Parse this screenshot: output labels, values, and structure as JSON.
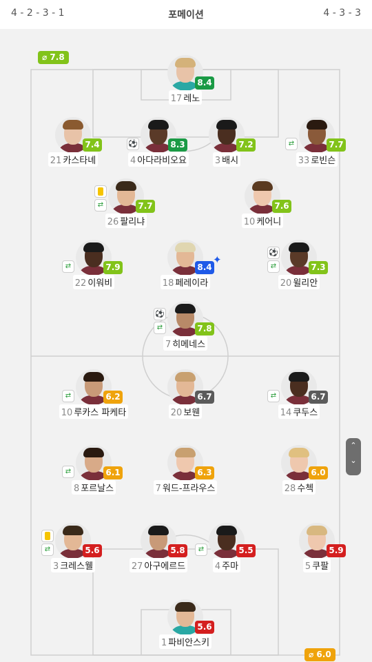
{
  "header": {
    "home_formation": "4 - 2 - 3 - 1",
    "title": "포메이션",
    "away_formation": "4 - 3 - 3"
  },
  "team_ratings": {
    "home": "7.8",
    "away": "6.0",
    "avg_symbol": "⌀"
  },
  "colors": {
    "rating_green": "#82c31a",
    "rating_dark_green": "#1a9a45",
    "rating_blue": "#1f5ae8",
    "rating_gray": "#5b5b5b",
    "rating_orange": "#efa30c",
    "rating_red": "#d41f1f",
    "home_shirt": "#7a2f3a",
    "gk_shirt": "#2aa8a4"
  },
  "players": [
    {
      "id": "reno",
      "number": "17",
      "name": "레노",
      "rating": "8.4",
      "rating_color": "#1a9a45",
      "gk": true,
      "skin": "#e8c3a8",
      "hair": "#d4b27a",
      "events": []
    },
    {
      "id": "castagne",
      "number": "21",
      "name": "카스타녜",
      "rating": "7.4",
      "rating_color": "#82c31a",
      "skin": "#e8c3a8",
      "hair": "#8a5a30",
      "events": []
    },
    {
      "id": "adarabioyo",
      "number": "4",
      "name": "아다라비오요",
      "rating": "8.3",
      "rating_color": "#1a9a45",
      "skin": "#5a3a28",
      "hair": "#1a1a1a",
      "events": [
        "ball"
      ]
    },
    {
      "id": "bassey",
      "number": "3",
      "name": "배시",
      "rating": "7.2",
      "rating_color": "#82c31a",
      "skin": "#4a2e20",
      "hair": "#1a1a1a",
      "events": []
    },
    {
      "id": "robinson",
      "number": "33",
      "name": "로빈슨",
      "rating": "7.7",
      "rating_color": "#82c31a",
      "skin": "#8a5a3a",
      "hair": "#2a1a10",
      "events": [
        "sub"
      ]
    },
    {
      "id": "palhinha",
      "number": "26",
      "name": "팔리냐",
      "rating": "7.7",
      "rating_color": "#82c31a",
      "skin": "#e3b896",
      "hair": "#3a2a1a",
      "events": [
        "yellow",
        "sub"
      ]
    },
    {
      "id": "cairney",
      "number": "10",
      "name": "케어니",
      "rating": "7.6",
      "rating_color": "#82c31a",
      "skin": "#efc8ae",
      "hair": "#5a3a20",
      "events": []
    },
    {
      "id": "iwobi",
      "number": "22",
      "name": "이워비",
      "rating": "7.9",
      "rating_color": "#82c31a",
      "skin": "#4a2e20",
      "hair": "#1a1a1a",
      "events": [
        "sub"
      ]
    },
    {
      "id": "pereira",
      "number": "18",
      "name": "페레이라",
      "rating": "8.4",
      "rating_color": "#1f5ae8",
      "skin": "#e3b896",
      "hair": "#e0d6b0",
      "star": true,
      "events": []
    },
    {
      "id": "willian",
      "number": "20",
      "name": "윌리안",
      "rating": "7.3",
      "rating_color": "#82c31a",
      "skin": "#5a3a28",
      "hair": "#1a1a1a",
      "events": [
        "ball",
        "sub"
      ]
    },
    {
      "id": "jimenez",
      "number": "7",
      "name": "히메네스",
      "rating": "7.8",
      "rating_color": "#82c31a",
      "skin": "#b88a68",
      "hair": "#1a1a1a",
      "events": [
        "ball",
        "sub"
      ]
    },
    {
      "id": "paqueta",
      "number": "10",
      "name": "루카스 파케타",
      "rating": "6.2",
      "rating_color": "#efa30c",
      "skin": "#c89a78",
      "hair": "#2a1a10",
      "events": [
        "sub"
      ]
    },
    {
      "id": "bowen",
      "number": "20",
      "name": "보웬",
      "rating": "6.7",
      "rating_color": "#5b5b5b",
      "skin": "#e3b896",
      "hair": "#c8a070",
      "events": []
    },
    {
      "id": "kudus",
      "number": "14",
      "name": "쿠두스",
      "rating": "6.7",
      "rating_color": "#5b5b5b",
      "skin": "#4a2e20",
      "hair": "#1a1a1a",
      "events": [
        "sub"
      ]
    },
    {
      "id": "soler",
      "number": "8",
      "name": "포르날스",
      "rating": "6.1",
      "rating_color": "#efa30c",
      "skin": "#d8aa88",
      "hair": "#2a1a10",
      "events": [
        "sub"
      ]
    },
    {
      "id": "ward-prowse",
      "number": "7",
      "name": "워드-프라우스",
      "rating": "6.3",
      "rating_color": "#efa30c",
      "skin": "#efc8ae",
      "hair": "#c8a070",
      "events": []
    },
    {
      "id": "soucek",
      "number": "28",
      "name": "수첵",
      "rating": "6.0",
      "rating_color": "#efa30c",
      "skin": "#efc8ae",
      "hair": "#e0c080",
      "events": []
    },
    {
      "id": "cresswell",
      "number": "3",
      "name": "크레스웰",
      "rating": "5.6",
      "rating_color": "#d41f1f",
      "skin": "#e3b896",
      "hair": "#3a2a1a",
      "events": [
        "yellow",
        "sub"
      ]
    },
    {
      "id": "aguerd",
      "number": "27",
      "name": "아구에르드",
      "rating": "5.8",
      "rating_color": "#d41f1f",
      "skin": "#c89a78",
      "hair": "#1a1a1a",
      "events": []
    },
    {
      "id": "zouma",
      "number": "4",
      "name": "주마",
      "rating": "5.5",
      "rating_color": "#d41f1f",
      "skin": "#4a2e20",
      "hair": "#1a1a1a",
      "events": [
        "sub"
      ]
    },
    {
      "id": "coufal",
      "number": "5",
      "name": "쿠팔",
      "rating": "5.9",
      "rating_color": "#d41f1f",
      "skin": "#efc8ae",
      "hair": "#d8b880",
      "events": []
    },
    {
      "id": "fabianski",
      "number": "1",
      "name": "파비안스키",
      "rating": "5.6",
      "rating_color": "#d41f1f",
      "gk": true,
      "skin": "#e3b896",
      "hair": "#3a2a1a",
      "events": []
    }
  ],
  "scroll_control": {
    "up": "⌃",
    "down": "⌄"
  }
}
